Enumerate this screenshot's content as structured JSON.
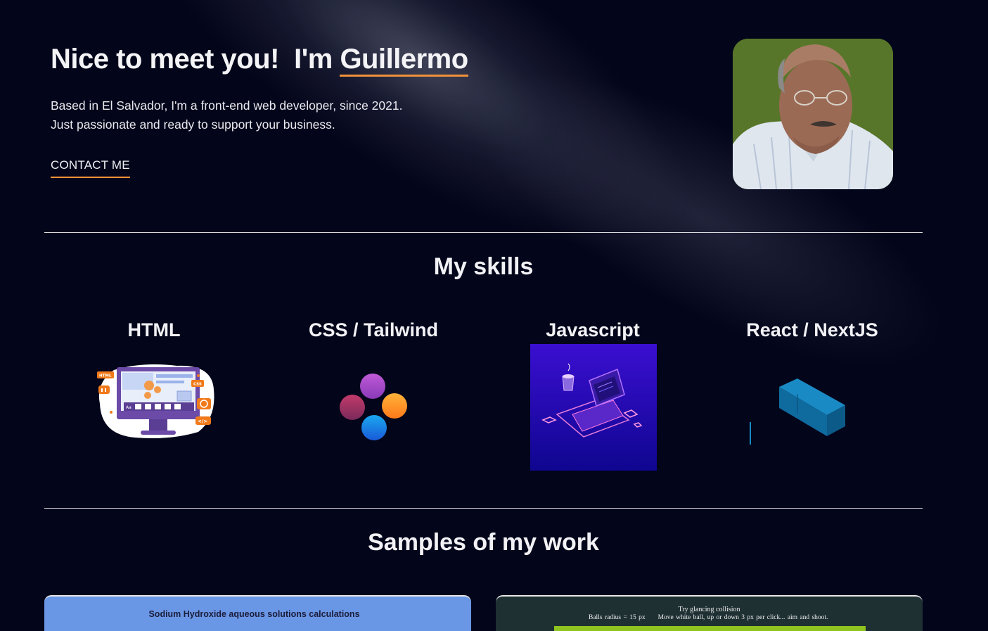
{
  "hero": {
    "greeting": "Nice to meet you!  I'm ",
    "name": "Guillermo",
    "line1": "Based in El Salvador, I'm a front-end web developer, since 2021.",
    "line2": "Just passionate and ready to support your business.",
    "contact_label": "CONTACT ME"
  },
  "skills": {
    "title": "My skills",
    "items": [
      {
        "label": "HTML"
      },
      {
        "label": "CSS / Tailwind"
      },
      {
        "label": "Javascript"
      },
      {
        "label": "React / NextJS"
      }
    ]
  },
  "work": {
    "title": "Samples of my work",
    "card1_title": "Sodium Hydroxide aqueous solutions calculations",
    "card2_line1": "Try glancing collision",
    "card2_line2a": "Balls radius = 15 px",
    "card2_line2b": "Move white ball, up or down 3 px per click... aim and shoot."
  },
  "html_art_badges": {
    "html": "HTML",
    "css": "CSS",
    "code": "</>",
    "aa": "Aa"
  },
  "colors": {
    "background": "#03051a",
    "accent": "#f0913a",
    "text": "#f2f2f6"
  }
}
